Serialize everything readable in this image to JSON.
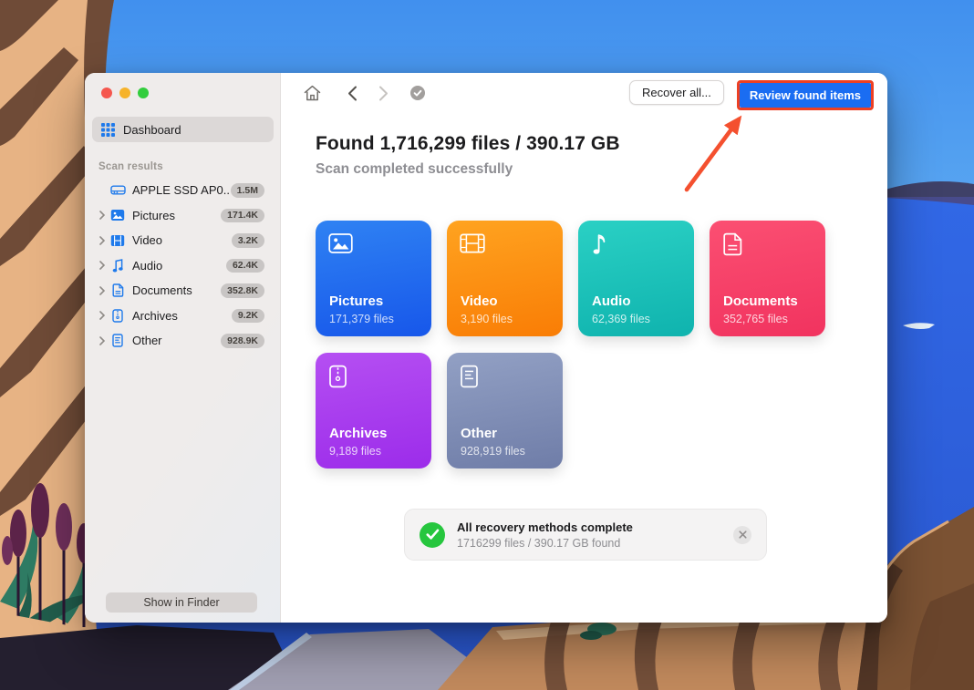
{
  "desktop": {
    "wallpaper": "macos-cliff-ocean-illustration",
    "sky_color": "#4392EE",
    "ocean_color": "#2F64E0"
  },
  "window": {
    "traffic_lights": [
      "close",
      "minimize",
      "zoom"
    ],
    "sidebar": {
      "dashboard_label": "Dashboard",
      "section_label": "Scan results",
      "items": [
        {
          "label": "APPLE SSD AP0...",
          "badge": "1.5M",
          "icon": "drive-icon",
          "has_chevron": false
        },
        {
          "label": "Pictures",
          "badge": "171.4K",
          "icon": "pictures-icon",
          "has_chevron": true
        },
        {
          "label": "Video",
          "badge": "3.2K",
          "icon": "video-icon",
          "has_chevron": true
        },
        {
          "label": "Audio",
          "badge": "62.4K",
          "icon": "audio-icon",
          "has_chevron": true
        },
        {
          "label": "Documents",
          "badge": "352.8K",
          "icon": "documents-icon",
          "has_chevron": true
        },
        {
          "label": "Archives",
          "badge": "9.2K",
          "icon": "archives-icon",
          "has_chevron": true
        },
        {
          "label": "Other",
          "badge": "928.9K",
          "icon": "other-icon",
          "has_chevron": true
        }
      ],
      "show_in_finder_label": "Show in Finder",
      "icon_accent_color": "#1f7aeb"
    },
    "toolbar": {
      "recover_all_label": "Recover all...",
      "review_found_label": "Review found items",
      "review_button_color": "#1a6df2"
    },
    "main": {
      "title": "Found 1,716,299 files / 390.17 GB",
      "subtitle": "Scan completed successfully",
      "cards": [
        {
          "label": "Pictures",
          "count": "171,379 files",
          "gradient_top": "#2f82f3",
          "gradient_bottom": "#1757ea"
        },
        {
          "label": "Video",
          "count": "3,190 files",
          "gradient_top": "#ffa320",
          "gradient_bottom": "#f97d05"
        },
        {
          "label": "Audio",
          "count": "62,369 files",
          "gradient_top": "#2ad0c4",
          "gradient_bottom": "#0fb3ae"
        },
        {
          "label": "Documents",
          "count": "352,765 files",
          "gradient_top": "#fb4f72",
          "gradient_bottom": "#f1335f"
        },
        {
          "label": "Archives",
          "count": "9,189 files",
          "gradient_top": "#b54ff2",
          "gradient_bottom": "#9c2cea"
        },
        {
          "label": "Other",
          "count": "928,919 files",
          "gradient_top": "#92a0c4",
          "gradient_bottom": "#6f7da8"
        }
      ],
      "notification": {
        "title": "All recovery methods complete",
        "subtitle": "1716299 files / 390.17 GB found",
        "status_color": "#26c63e"
      }
    }
  },
  "annotation": {
    "highlight_color": "#ee4023",
    "arrow_color": "#f4502f"
  }
}
